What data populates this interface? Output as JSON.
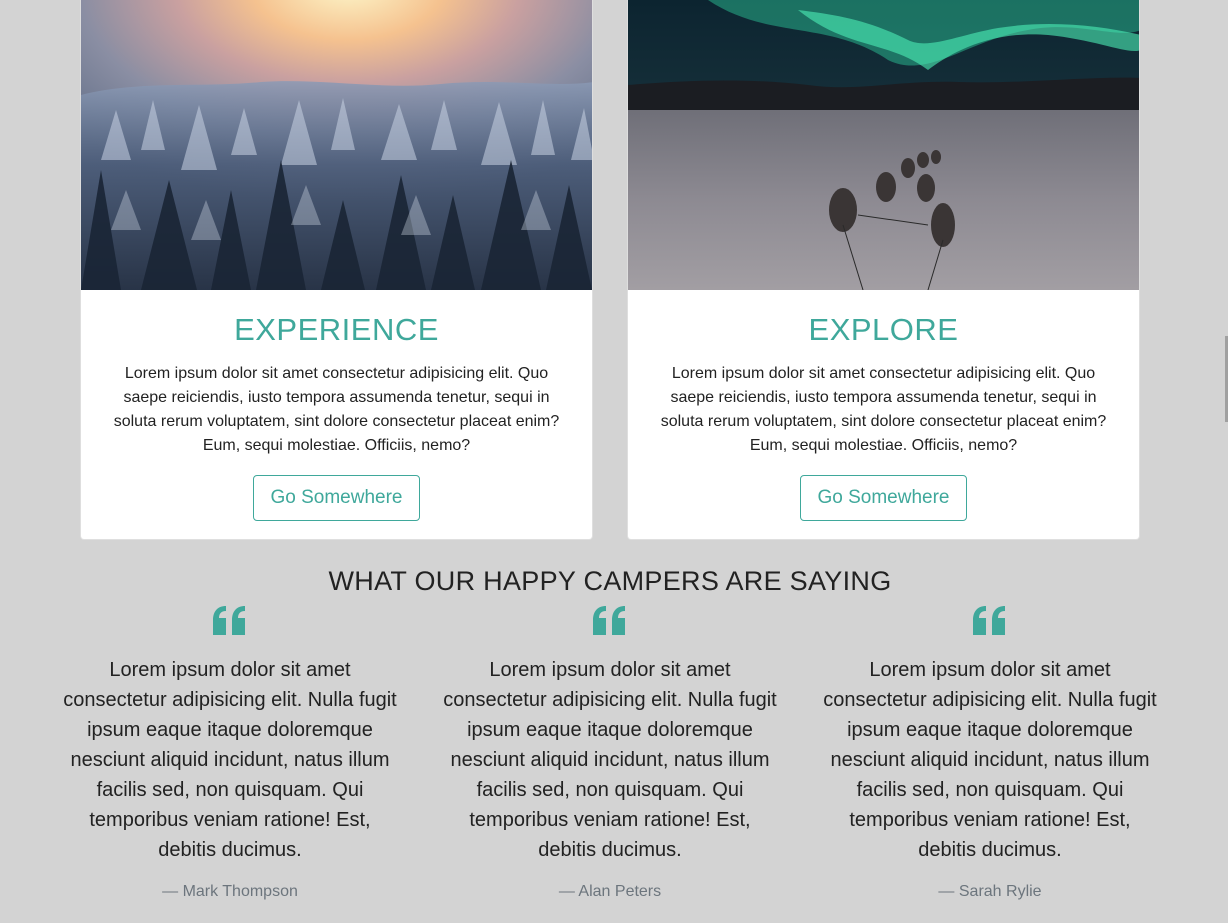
{
  "colors": {
    "accent": "#3fa89b",
    "page_background": "#d3d3d3",
    "card_background": "#ffffff",
    "muted_text": "#6c757d"
  },
  "cards": [
    {
      "image_icon": "snowy-forest-sunrise-image",
      "title": "EXPERIENCE",
      "text": "Lorem ipsum dolor sit amet consectetur adipisicing elit. Quo saepe reiciendis, iusto tempora assumenda tenetur, sequi in soluta rerum voluptatem, sint dolore consectetur placeat enim? Eum, sequi molestiae. Officiis, nemo?",
      "button_label": "Go Somewhere"
    },
    {
      "image_icon": "aurora-dog-sled-image",
      "title": "EXPLORE",
      "text": "Lorem ipsum dolor sit amet consectetur adipisicing elit. Quo saepe reiciendis, iusto tempora assumenda tenetur, sequi in soluta rerum voluptatem, sint dolore consectetur placeat enim? Eum, sequi molestiae. Officiis, nemo?",
      "button_label": "Go Somewhere"
    }
  ],
  "testimonials_section": {
    "title": "WHAT OUR HAPPY CAMPERS ARE SAYING",
    "items": [
      {
        "icon": "quote-left-icon",
        "text": "Lorem ipsum dolor sit amet consectetur adipisicing elit. Nulla fugit ipsum eaque itaque doloremque nesciunt aliquid incidunt, natus illum facilis sed, non quisquam. Qui temporibus veniam ratione! Est, debitis ducimus.",
        "author": "— Mark Thompson"
      },
      {
        "icon": "quote-left-icon",
        "text": "Lorem ipsum dolor sit amet consectetur adipisicing elit. Nulla fugit ipsum eaque itaque doloremque nesciunt aliquid incidunt, natus illum facilis sed, non quisquam. Qui temporibus veniam ratione! Est, debitis ducimus.",
        "author": "— Alan Peters"
      },
      {
        "icon": "quote-left-icon",
        "text": "Lorem ipsum dolor sit amet consectetur adipisicing elit. Nulla fugit ipsum eaque itaque doloremque nesciunt aliquid incidunt, natus illum facilis sed, non quisquam. Qui temporibus veniam ratione! Est, debitis ducimus.",
        "author": "— Sarah Rylie"
      }
    ]
  }
}
